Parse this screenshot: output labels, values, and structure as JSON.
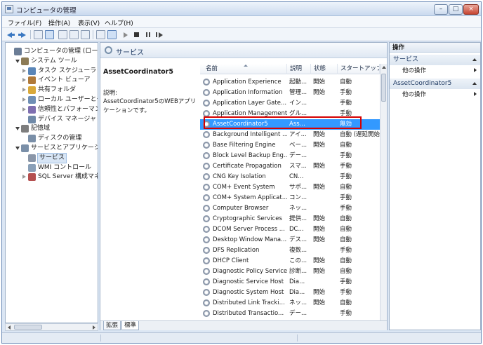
{
  "window": {
    "title": "コンピュータの管理",
    "buttons": {
      "minimize": "–",
      "maximize": "□",
      "close": "×"
    }
  },
  "menu": [
    "ファイル(F)",
    "操作(A)",
    "表示(V)",
    "ヘルプ(H)"
  ],
  "tree": [
    {
      "label": "コンピュータの管理 (ローカル)",
      "level": 0,
      "expander": "none",
      "icon": "computer-icon"
    },
    {
      "label": "システム ツール",
      "level": 1,
      "expander": "open",
      "icon": "tools-icon"
    },
    {
      "label": "タスク スケジューラ",
      "level": 2,
      "expander": "closed",
      "icon": "clock-icon"
    },
    {
      "label": "イベント ビューア",
      "level": 2,
      "expander": "closed",
      "icon": "event-viewer-icon"
    },
    {
      "label": "共有フォルダ",
      "level": 2,
      "expander": "closed",
      "icon": "shared-folder-icon"
    },
    {
      "label": "ローカル ユーザーとグループ",
      "level": 2,
      "expander": "closed",
      "icon": "users-icon"
    },
    {
      "label": "信頼性とパフォーマンス",
      "level": 2,
      "expander": "closed",
      "icon": "performance-icon"
    },
    {
      "label": "デバイス マネージャ",
      "level": 2,
      "expander": "none",
      "icon": "device-manager-icon"
    },
    {
      "label": "記憶域",
      "level": 1,
      "expander": "open",
      "icon": "storage-icon"
    },
    {
      "label": "ディスクの管理",
      "level": 2,
      "expander": "none",
      "icon": "disk-icon"
    },
    {
      "label": "サービスとアプリケーション",
      "level": 1,
      "expander": "open",
      "icon": "services-apps-icon"
    },
    {
      "label": "サービス",
      "level": 2,
      "expander": "none",
      "icon": "services-icon",
      "selected": true
    },
    {
      "label": "WMI コントロール",
      "level": 2,
      "expander": "none",
      "icon": "wmi-icon"
    },
    {
      "label": "SQL Server 構成マネージャ",
      "level": 2,
      "expander": "closed",
      "icon": "sql-server-icon"
    }
  ],
  "center": {
    "header": "サービス",
    "detail": {
      "title": "AssetCoordinator5",
      "desc_label": "説明:",
      "desc_text": "AssetCoordinator5のWEBアプリケーションです。"
    },
    "columns": [
      "名前",
      "説明",
      "状態",
      "スタートアップ"
    ],
    "services": [
      {
        "name": "Application Experience",
        "desc": "起動...",
        "status": "開始",
        "startup": "自動"
      },
      {
        "name": "Application Information",
        "desc": "管理...",
        "status": "開始",
        "startup": "手動"
      },
      {
        "name": "Application Layer Gate...",
        "desc": "イン...",
        "status": "",
        "startup": "手動"
      },
      {
        "name": "Application Management",
        "desc": "グル...",
        "status": "",
        "startup": "手動"
      },
      {
        "name": "AssetCoordinator5",
        "desc": "Ass...",
        "status": "",
        "startup": "無効",
        "selected": true
      },
      {
        "name": "Background Intelligent ...",
        "desc": "アイ...",
        "status": "開始",
        "startup": "自動 (遅延開始)"
      },
      {
        "name": "Base Filtering Engine",
        "desc": "ベー...",
        "status": "開始",
        "startup": "自動"
      },
      {
        "name": "Block Level Backup Eng...",
        "desc": "デー...",
        "status": "",
        "startup": "手動"
      },
      {
        "name": "Certificate Propagation",
        "desc": "スマ...",
        "status": "開始",
        "startup": "手動"
      },
      {
        "name": "CNG Key Isolation",
        "desc": "CN...",
        "status": "",
        "startup": "手動"
      },
      {
        "name": "COM+ Event System",
        "desc": "サポ...",
        "status": "開始",
        "startup": "自動"
      },
      {
        "name": "COM+ System Applicat...",
        "desc": "コン...",
        "status": "",
        "startup": "手動"
      },
      {
        "name": "Computer Browser",
        "desc": "ネッ...",
        "status": "",
        "startup": "手動"
      },
      {
        "name": "Cryptographic Services",
        "desc": "提供...",
        "status": "開始",
        "startup": "自動"
      },
      {
        "name": "DCOM Server Process ...",
        "desc": "DC...",
        "status": "開始",
        "startup": "自動"
      },
      {
        "name": "Desktop Window Mana...",
        "desc": "デス...",
        "status": "開始",
        "startup": "自動"
      },
      {
        "name": "DFS Replication",
        "desc": "複数...",
        "status": "",
        "startup": "手動"
      },
      {
        "name": "DHCP Client",
        "desc": "この...",
        "status": "開始",
        "startup": "自動"
      },
      {
        "name": "Diagnostic Policy Service",
        "desc": "診断...",
        "status": "開始",
        "startup": "自動"
      },
      {
        "name": "Diagnostic Service Host",
        "desc": "Dia...",
        "status": "",
        "startup": "手動"
      },
      {
        "name": "Diagnostic System Host",
        "desc": "Dia...",
        "status": "開始",
        "startup": "手動"
      },
      {
        "name": "Distributed Link Tracki...",
        "desc": "ネッ...",
        "status": "開始",
        "startup": "自動"
      },
      {
        "name": "Distributed Transactio...",
        "desc": "デー...",
        "status": "",
        "startup": "手動"
      }
    ],
    "tabs": [
      "拡張",
      "標準"
    ]
  },
  "actions": {
    "header": "操作",
    "sections": [
      {
        "title": "サービス",
        "item": "他の操作"
      },
      {
        "title": "AssetCoordinator5",
        "item": "他の操作"
      }
    ]
  },
  "colors": {
    "selection": "#3399ff",
    "highlight_box": "#d40000"
  }
}
